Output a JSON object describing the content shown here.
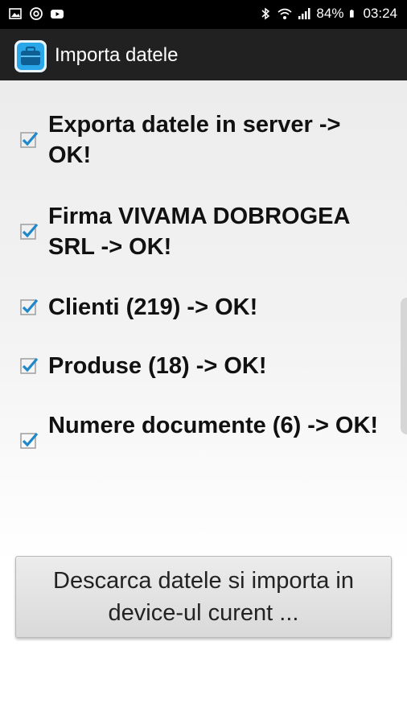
{
  "status_bar": {
    "battery": "84%",
    "time": "03:24",
    "icons": [
      "gallery-icon",
      "at-icon",
      "youtube-icon",
      "bluetooth-icon",
      "wifi-icon",
      "signal-icon",
      "battery-icon"
    ]
  },
  "app_bar": {
    "title": "Importa datele",
    "icon": "briefcase-icon"
  },
  "items": [
    {
      "label": "Exporta datele in server -> OK!",
      "checked": true
    },
    {
      "label": "Firma VIVAMA DOBROGEA SRL -> OK!",
      "checked": true
    },
    {
      "label": "Clienti (219) -> OK!",
      "checked": true
    },
    {
      "label": "Produse (18) -> OK!",
      "checked": true
    },
    {
      "label": "Numere documente (6) -> OK!",
      "checked": true
    }
  ],
  "action_button": {
    "label": "Descarca datele si importa in device-ul curent ..."
  },
  "colors": {
    "check_blue": "#1e88c9",
    "app_bar": "#212121",
    "app_icon_bg": "#2aa7e8"
  }
}
